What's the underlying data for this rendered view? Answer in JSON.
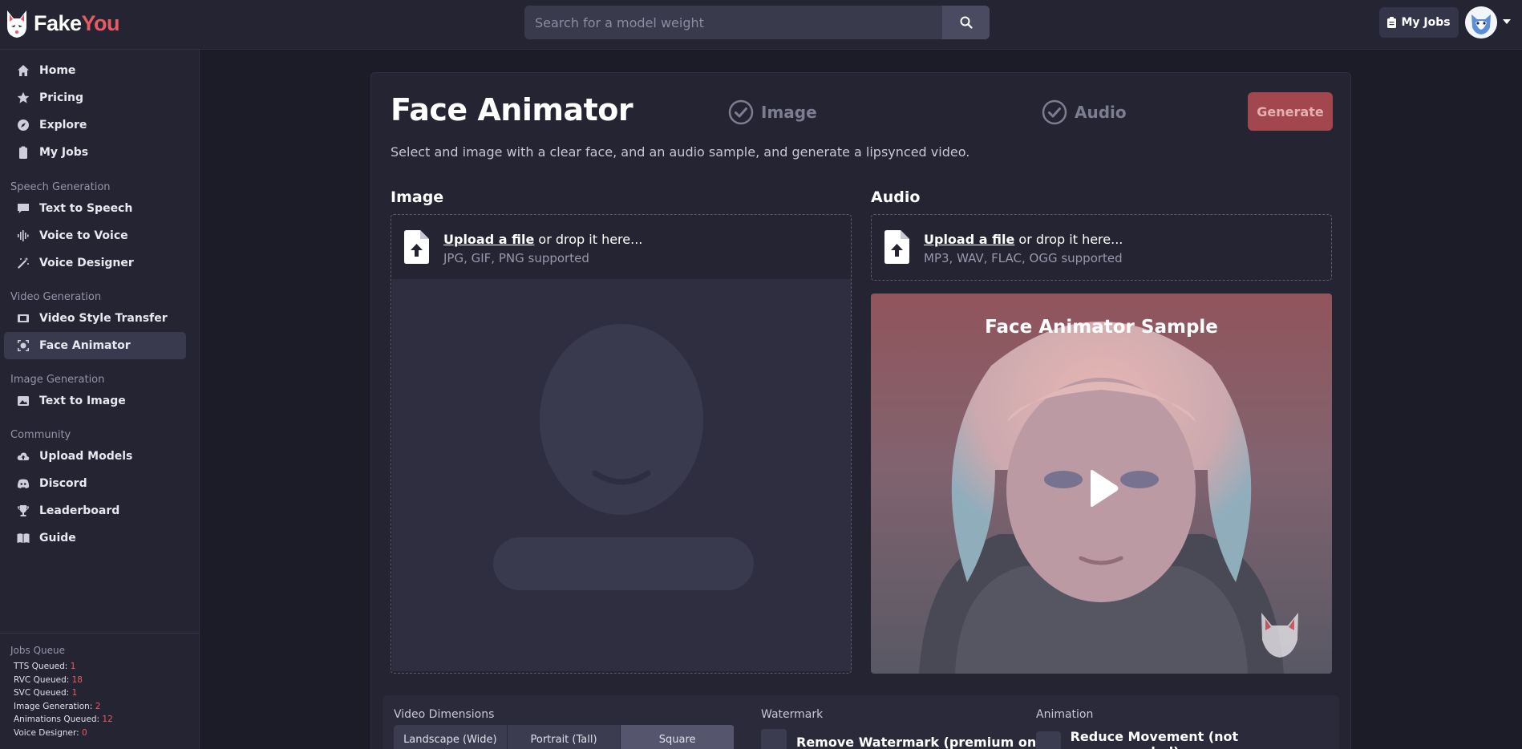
{
  "brand": {
    "name_part1": "Fake",
    "name_part2": "You",
    "accent": "#e85b63"
  },
  "search": {
    "placeholder": "Search for a model weight"
  },
  "header": {
    "my_jobs_label": "My Jobs"
  },
  "sidebar": {
    "items": [
      {
        "label": "Home",
        "icon": "home-icon"
      },
      {
        "label": "Pricing",
        "icon": "star-icon"
      },
      {
        "label": "Explore",
        "icon": "compass-icon"
      },
      {
        "label": "My Jobs",
        "icon": "clipboard-icon"
      }
    ],
    "sections": [
      {
        "label": "Speech Generation",
        "items": [
          {
            "label": "Text to Speech",
            "icon": "speech-bubble-icon"
          },
          {
            "label": "Voice to Voice",
            "icon": "waveform-icon"
          },
          {
            "label": "Voice Designer",
            "icon": "magic-wand-icon"
          }
        ]
      },
      {
        "label": "Video Generation",
        "items": [
          {
            "label": "Video Style Transfer",
            "icon": "film-icon"
          },
          {
            "label": "Face Animator",
            "icon": "face-scan-icon",
            "active": true
          }
        ]
      },
      {
        "label": "Image Generation",
        "items": [
          {
            "label": "Text to Image",
            "icon": "image-icon"
          }
        ]
      },
      {
        "label": "Community",
        "items": [
          {
            "label": "Upload Models",
            "icon": "cloud-upload-icon"
          },
          {
            "label": "Discord",
            "icon": "discord-icon"
          },
          {
            "label": "Leaderboard",
            "icon": "trophy-icon"
          },
          {
            "label": "Guide",
            "icon": "book-icon"
          }
        ]
      }
    ]
  },
  "queue": {
    "title": "Jobs Queue",
    "lines": [
      {
        "label": "TTS Queued:",
        "value": "1"
      },
      {
        "label": "RVC Queued:",
        "value": "18"
      },
      {
        "label": "SVC Queued:",
        "value": "1"
      },
      {
        "label": "Image Generation:",
        "value": "2"
      },
      {
        "label": "Animations Queued:",
        "value": "12"
      },
      {
        "label": "Voice Designer:",
        "value": "0"
      }
    ]
  },
  "main": {
    "title": "Face Animator",
    "steps": [
      "Image",
      "Audio"
    ],
    "generate_label": "Generate",
    "subtitle": "Select and image with a clear face, and an audio sample, and generate a lipsynced video.",
    "image_col": {
      "title": "Image",
      "upload_link": "Upload a file",
      "upload_rest": " or drop it here...",
      "formats": "JPG, GIF, PNG supported"
    },
    "audio_col": {
      "title": "Audio",
      "upload_link": "Upload a file",
      "upload_rest": " or drop it here...",
      "formats": "MP3, WAV, FLAC, OGG supported"
    },
    "sample_title": "Face Animator Sample",
    "settings": {
      "video_dimensions_label": "Video Dimensions",
      "dimension_options": [
        "Landscape (Wide)",
        "Portrait (Tall)",
        "Square"
      ],
      "selected_dimension": "Square",
      "watermark_label": "Watermark",
      "watermark_option": "Remove Watermark (premium only)",
      "animation_label": "Animation",
      "animation_option": "Reduce Movement (not recommended)"
    }
  }
}
